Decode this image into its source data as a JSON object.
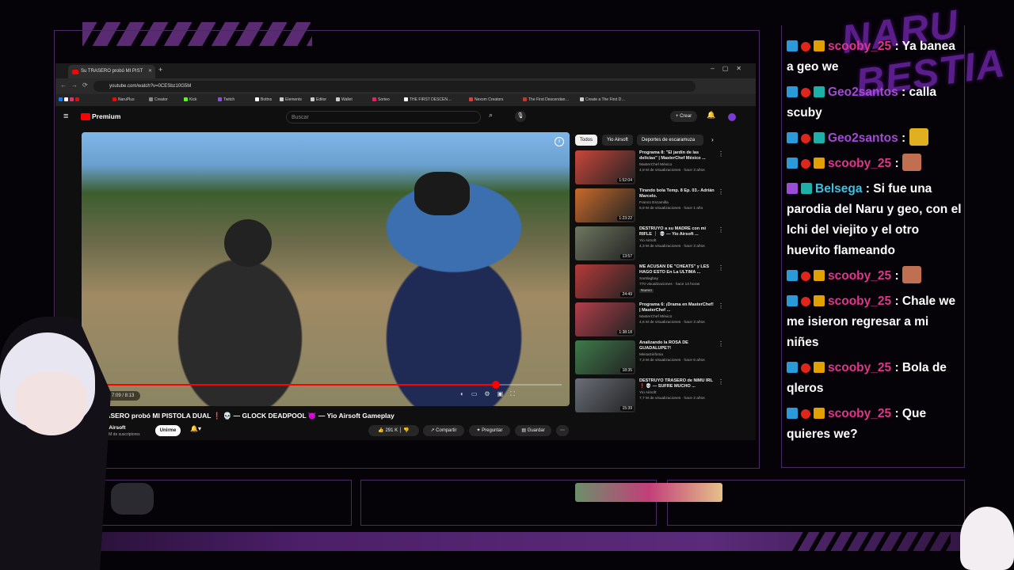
{
  "overlay": {
    "logo_line1": "NARU",
    "logo_line2": "BESTIA"
  },
  "browser": {
    "tab_title": "Su TRASERO probó MI PIST",
    "url": "youtube.com/watch?v=0CESbz10G5M",
    "bookmarks": [
      "NaruPlus",
      "Creator",
      "Kick",
      "Twitch",
      "Bottns",
      "Elements",
      "Editor",
      "Wallet",
      "Sorteo",
      "THE FIRST DESCEN…",
      "Nexom Creators",
      "The First Descendan…",
      "Create a The First D…"
    ]
  },
  "youtube": {
    "logo": "Premium",
    "search_placeholder": "Buscar",
    "create_label": "+ Crear",
    "player": {
      "time": "7:09 / 8:13",
      "progress": 0.86
    },
    "video_title": "TRASERO probó MI PISTOLA DUAL ❗ 💀 — GLOCK DEADPOOL 😈 — Yio Airsoft Gameplay",
    "channel": "Yio Airsoft",
    "subscribers": "5,61 M de suscriptores",
    "join_label": "Unirme",
    "likes": "291 K",
    "share_label": "Compartir",
    "ask_label": "Preguntar",
    "save_label": "Guardar",
    "chips": [
      "Todos",
      "Yio Airsoft",
      "Deportes de escaramuza"
    ],
    "recommended": [
      {
        "title": "Programa 8: \"El jardín de las delicias\" | MasterChef México ...",
        "channel": "MasterChef México",
        "meta": "4,9 M de visualizaciones · hace 3 años",
        "duration": "1:52:04",
        "color": "#c9463b"
      },
      {
        "title": "Tirando bola Temp. 8 Ep. 03.- Adrián Marcelo.",
        "channel": "Franco Escamilla",
        "meta": "5,9 M de visualizaciones · hace 1 año",
        "duration": "1:23:22",
        "color": "#c86a2b"
      },
      {
        "title": "DESTRUYO a su MADRE con mi RIFLE ❗ 💀 — Yio Airsoft ...",
        "channel": "Yio Airsoft",
        "meta": "4,3 M de visualizaciones · hace 3 años",
        "duration": "13:57",
        "color": "#6f7760"
      },
      {
        "title": "ME ACUSAN DE \"CHEATS\" y LES HAGO ESTO En La ULTIMA ...",
        "channel": "Santiagbay",
        "meta": "770 visualizaciones · hace 14 horas",
        "duration": "24:49",
        "badge": "Nuevo",
        "color": "#b63a3a"
      },
      {
        "title": "Programa 6: ¡Drama en MasterChef! | MasterChef ...",
        "channel": "MasterChef México",
        "meta": "4,6 M de visualizaciones · hace 3 años",
        "duration": "1:38:18",
        "color": "#b23f4a"
      },
      {
        "title": "Analizando la ROSA DE GUADALUPE?!",
        "channel": "MissaSinfonia",
        "meta": "7,3 M de visualizaciones · hace 6 años",
        "duration": "18:35",
        "color": "#3f7a4a"
      },
      {
        "title": "DESTRUYO TRASERO de NIMU IRL ❗ 💀 — SUFRE MUCHO ...",
        "channel": "Yio Airsoft",
        "meta": "7,7 M de visualizaciones · hace 2 años",
        "duration": "15:39",
        "color": "#6a6e78"
      }
    ]
  },
  "chat": {
    "messages": [
      {
        "badges": [
          "blue",
          "red",
          "gold"
        ],
        "user": "scooby_25",
        "user_color": "#e0368a",
        "text": "Ya banea a geo we"
      },
      {
        "badges": [
          "blue",
          "red",
          "cyan"
        ],
        "user": "Geo2santos",
        "user_color": "#a34ad6",
        "text": "calla scuby"
      },
      {
        "badges": [
          "blue",
          "red",
          "cyan"
        ],
        "user": "Geo2santos",
        "user_color": "#a34ad6",
        "text": "",
        "emote": "#e0b020"
      },
      {
        "badges": [
          "blue",
          "red",
          "gold"
        ],
        "user": "scooby_25",
        "user_color": "#e0368a",
        "text": "",
        "emote": "#c07050"
      },
      {
        "badges": [
          "purple",
          "cyan"
        ],
        "user": "Belsega",
        "user_color": "#3ec0e0",
        "text": "Si fue una parodia del Naru y geo, con el Ichi del viejito y el otro huevito flameando"
      },
      {
        "badges": [
          "blue",
          "red",
          "gold"
        ],
        "user": "scooby_25",
        "user_color": "#e0368a",
        "text": "",
        "emote": "#c07050"
      },
      {
        "badges": [
          "blue",
          "red",
          "gold"
        ],
        "user": "scooby_25",
        "user_color": "#e0368a",
        "text": "Chale we me isieron regresar a mi niñes"
      },
      {
        "badges": [
          "blue",
          "red",
          "gold"
        ],
        "user": "scooby_25",
        "user_color": "#e0368a",
        "text": "Bola de qleros"
      },
      {
        "badges": [
          "blue",
          "red",
          "gold"
        ],
        "user": "scooby_25",
        "user_color": "#e0368a",
        "text": "Que quieres we?"
      }
    ]
  }
}
